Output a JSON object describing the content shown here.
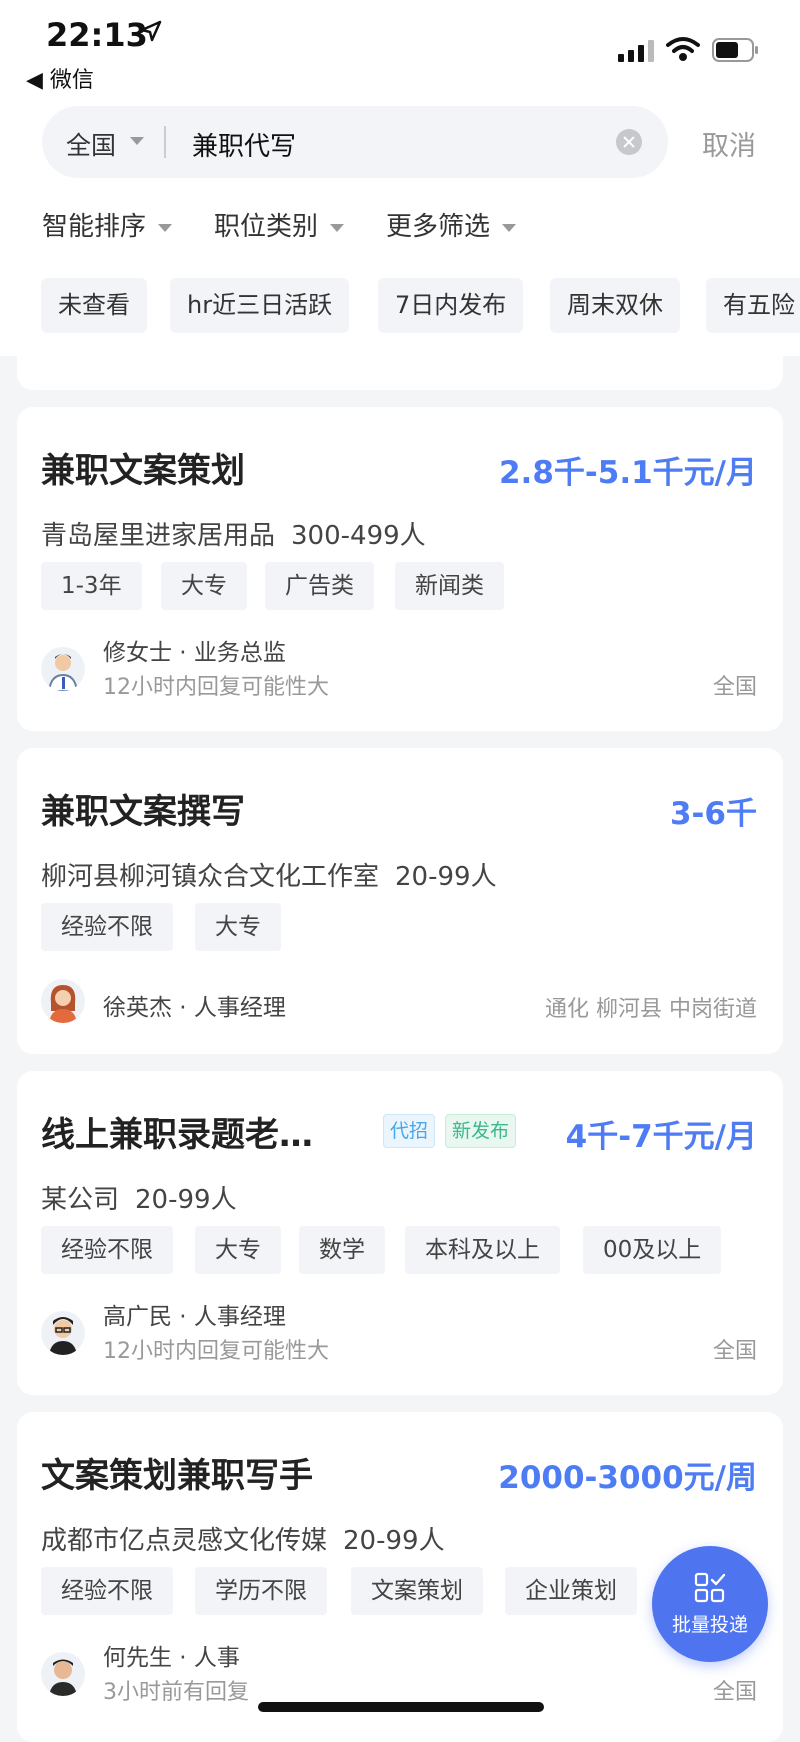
{
  "status_bar": {
    "time": "22:13",
    "back_app": "◀ 微信"
  },
  "search": {
    "region": "全国",
    "query": "兼职代写",
    "cancel": "取消"
  },
  "filters": [
    "智能排序",
    "职位类别",
    "更多筛选"
  ],
  "chips": [
    "未查看",
    "hr近三日活跃",
    "7日内发布",
    "周末双休",
    "有五险"
  ],
  "jobs": [
    {
      "title": "兼职文案策划",
      "salary": "2.8千-5.1千元/月",
      "company": "青岛屋里进家居用品",
      "size": "300-499人",
      "tags": [
        "1-3年",
        "大专",
        "广告类",
        "新闻类"
      ],
      "recruiter": "修女士 · 业务总监",
      "hint": "12小时内回复可能性大",
      "location": "全国"
    },
    {
      "title": "兼职文案撰写",
      "salary": "3-6千",
      "company": "柳河县柳河镇众合文化工作室",
      "size": "20-99人",
      "tags": [
        "经验不限",
        "大专"
      ],
      "recruiter": "徐英杰 · 人事经理",
      "hint": "",
      "location": "通化 柳河县 中岗街道"
    },
    {
      "title": "线上兼职录题老…",
      "badges": [
        "代招",
        "新发布"
      ],
      "salary": "4千-7千元/月",
      "company": "某公司",
      "size": "20-99人",
      "tags": [
        "经验不限",
        "大专",
        "数学",
        "本科及以上",
        "00及以上"
      ],
      "recruiter": "高广民 · 人事经理",
      "hint": "12小时内回复可能性大",
      "location": "全国"
    },
    {
      "title": "文案策划兼职写手",
      "salary": "2000-3000元/周",
      "company": "成都市亿点灵感文化传媒",
      "size": "20-99人",
      "tags": [
        "经验不限",
        "学历不限",
        "文案策划",
        "企业策划"
      ],
      "recruiter": "何先生 · 人事",
      "hint": "3小时前有回复",
      "location": "全国"
    }
  ],
  "fab": {
    "label": "批量投递"
  },
  "colors": {
    "accent": "#4e7cf5",
    "badge_agent": "#4aa8e8",
    "badge_new": "#3cb88a"
  }
}
